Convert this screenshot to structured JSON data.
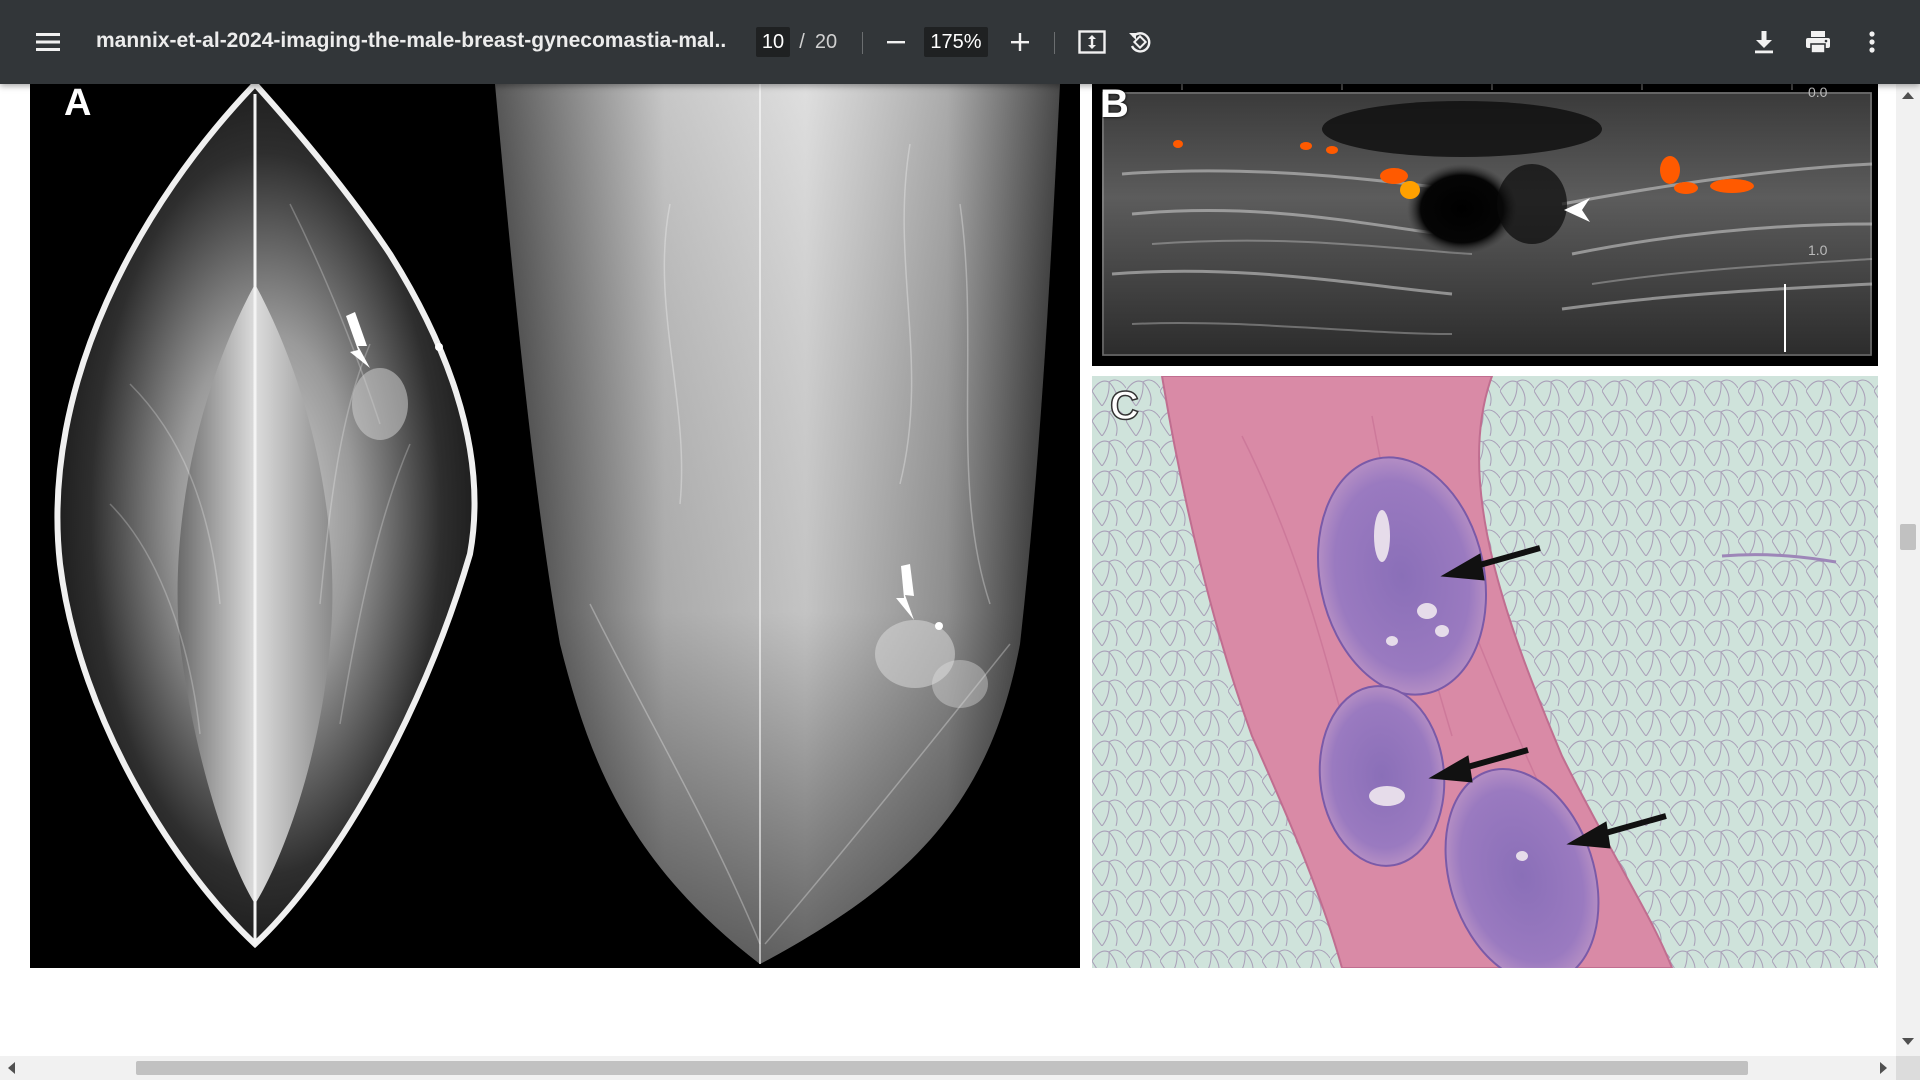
{
  "toolbar": {
    "menu_icon": "hamburger-menu-icon",
    "title": "mannix-et-al-2024-imaging-the-male-breast-gynecomastia-mal...",
    "current_page": "10",
    "separator": "/",
    "total_pages": "20",
    "zoom": "175%",
    "icons": {
      "zoom_out": "minus-icon",
      "zoom_in": "plus-icon",
      "fit": "fit-to-page-icon",
      "rotate": "rotate-icon",
      "download": "download-icon",
      "print": "print-icon",
      "more": "more-vertical-icon"
    }
  },
  "figure": {
    "panel_a_label": "A",
    "panel_b_label": "B",
    "panel_c_label": "C",
    "ultrasound_scale_top": "0.0",
    "ultrasound_scale_mid": "1.0"
  },
  "colors": {
    "toolbar_bg": "#323639",
    "histology_pink": "#d98aa6",
    "histology_bg": "#c9ded6",
    "doppler_orange": "#ff6a00"
  }
}
